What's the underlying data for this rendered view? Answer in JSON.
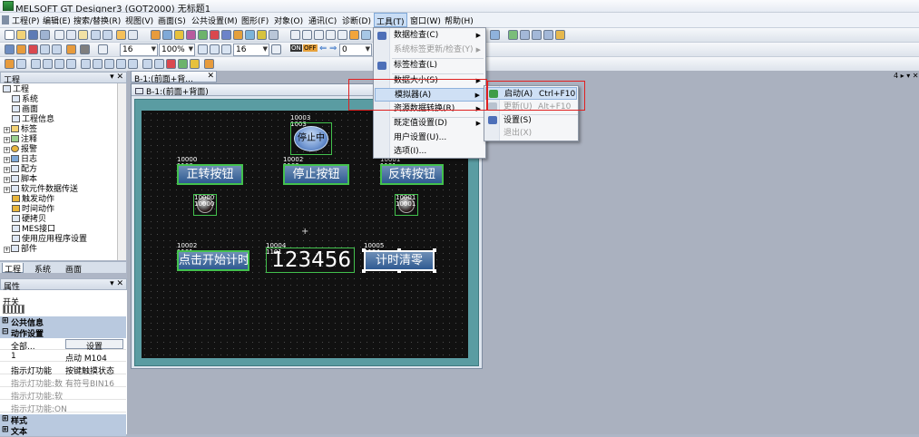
{
  "window": {
    "title": "MELSOFT GT Designer3 (GOT2000) 无标题1"
  },
  "menu": {
    "items": [
      "工程(P)",
      "编辑(E)",
      "搜索/替换(R)",
      "视图(V)",
      "画面(S)",
      "公共设置(M)",
      "图形(F)",
      "对象(O)",
      "通讯(C)",
      "诊断(D)",
      "工具(T)",
      "窗口(W)",
      "帮助(H)"
    ]
  },
  "toolbar": {
    "zoom_value": "100%",
    "grid_value": "16",
    "font_value": "16",
    "step_value": "0",
    "on_label": "ON",
    "off_label": "OFF"
  },
  "project_panel": {
    "title": "工程",
    "items": [
      "工程",
      "系统",
      "画面",
      "工程信息",
      "标签",
      "注释",
      "报警",
      "日志",
      "配方",
      "脚本",
      "软元件数据传送",
      "触发动作",
      "时间动作",
      "硬拷贝",
      "MES接口",
      "使用应用程序设置",
      "部件"
    ],
    "tabs": [
      "工程",
      "系统",
      "画面"
    ]
  },
  "property_panel": {
    "title": "属性",
    "object_label": "开关",
    "sections": {
      "common": "公共信息",
      "action": "动作设置",
      "style": "样式",
      "text": "文本"
    },
    "rows": [
      {
        "name": "全部...",
        "value": "设置"
      },
      {
        "name": "1",
        "value": "点动 M104"
      },
      {
        "name": "指示灯功能",
        "value": "按键触摸状态"
      },
      {
        "name": "指示灯功能:数",
        "value": "有符号BIN16"
      },
      {
        "name": "指示灯功能:软",
        "value": ""
      },
      {
        "name": "指示灯功能:ON",
        "value": ""
      }
    ]
  },
  "document": {
    "tab_label": "B-1:(前面+背...",
    "window_title": "B-1:(前面+背面)",
    "right_controls": "4 ▸ ▾ ✕"
  },
  "screen_objects": {
    "status_button": {
      "label": "停止中",
      "tag": "10003\n1003"
    },
    "forward_button": {
      "label": "正转按钮",
      "tag": "10000\n1100"
    },
    "stop_button": {
      "label": "停止按钮",
      "tag": "10002\n1102"
    },
    "reverse_button": {
      "label": "反转按钮",
      "tag": "10001\n1101"
    },
    "lamp_left": {
      "tag": "10000\n10000"
    },
    "lamp_right": {
      "tag": "10001\n10001"
    },
    "timer_start_button": {
      "label": "点击开始计时",
      "tag": "10002\n1101"
    },
    "numeric_display": {
      "value": "123456",
      "tag": "10004\n1101"
    },
    "timer_reset_button": {
      "label": "计时清零",
      "tag": "10005\n1104"
    }
  },
  "tools_menu": {
    "items": [
      {
        "label": "数据检查(C)",
        "has_sub": true,
        "enabled": true
      },
      {
        "label": "系统标签更新/检查(Y)",
        "has_sub": true,
        "enabled": false
      },
      {
        "label": "标签检查(L)",
        "has_sub": false,
        "enabled": true
      },
      {
        "label": "数据大小(S)",
        "has_sub": true,
        "enabled": true
      },
      {
        "label": "模拟器(A)",
        "has_sub": true,
        "enabled": true
      },
      {
        "label": "资源数据转换(R)",
        "has_sub": true,
        "enabled": true
      },
      {
        "label": "既定值设置(D)",
        "has_sub": true,
        "enabled": true
      },
      {
        "label": "用户设置(U)...",
        "has_sub": false,
        "enabled": true
      },
      {
        "label": "选项(I)...",
        "has_sub": false,
        "enabled": true
      }
    ]
  },
  "simulator_submenu": {
    "items": [
      {
        "label": "启动(A)",
        "shortcut": "Ctrl+F10",
        "enabled": true
      },
      {
        "label": "更新(U)",
        "shortcut": "Alt+F10",
        "enabled": false
      },
      {
        "label": "设置(S)",
        "shortcut": "",
        "enabled": true
      },
      {
        "label": "退出(X)",
        "shortcut": "",
        "enabled": false
      }
    ]
  },
  "colors": {
    "highlight": "#cfe0f5",
    "annotation_box": "#e02020",
    "object_border": "#43c14d"
  }
}
